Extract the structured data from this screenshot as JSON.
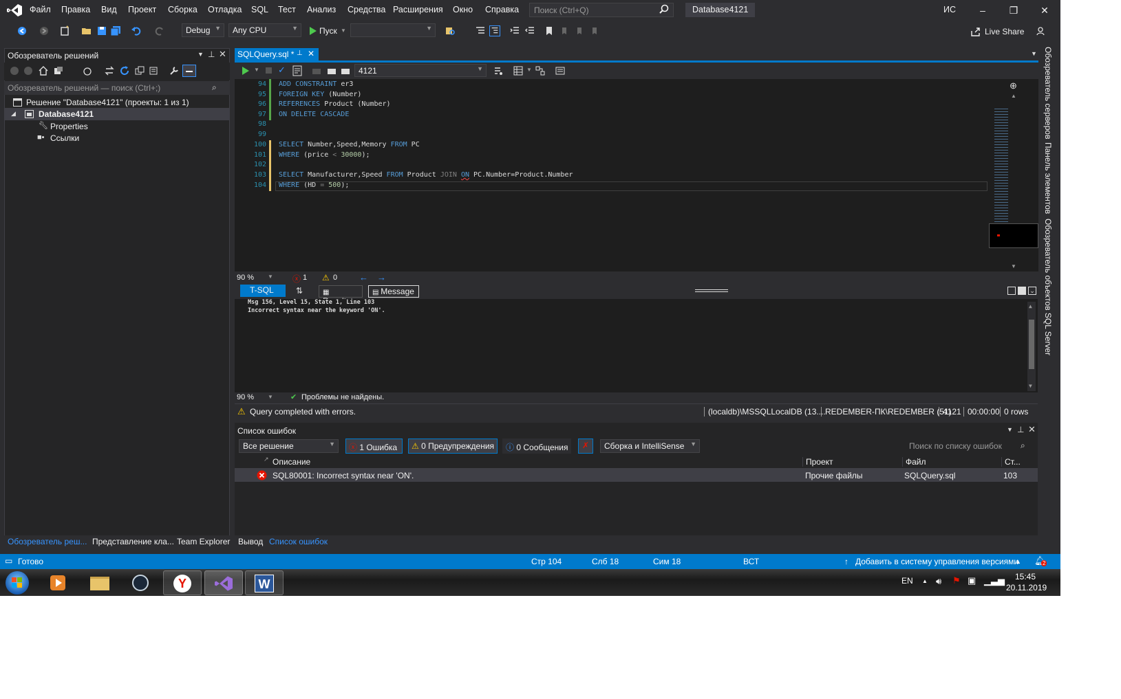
{
  "menu": {
    "items": [
      "Файл",
      "Правка",
      "Вид",
      "Проект",
      "Сборка",
      "Отладка",
      "SQL",
      "Тест",
      "Анализ",
      "Средства",
      "Расширения",
      "Окно",
      "Справка"
    ],
    "search_placeholder": "Поиск (Ctrl+Q)",
    "solution_name": "Database4121",
    "user_initials": "ИС"
  },
  "toolbar": {
    "config": "Debug",
    "platform": "Any CPU",
    "start_label": "Пуск",
    "live_share": "Live Share"
  },
  "solution_explorer": {
    "title": "Обозреватель решений",
    "search_placeholder": "Обозреватель решений — поиск (Ctrl+;)",
    "tree": [
      "Решение \"Database4121\" (проекты: 1 из 1)",
      "Database4121",
      "Properties",
      "Ссылки"
    ],
    "bottom_tabs": [
      "Обозреватель реш...",
      "Представление кла...",
      "Team Explorer"
    ]
  },
  "editor": {
    "tab_title": "SQLQuery.sql *",
    "database": "4121",
    "zoom": "90 %",
    "error_count": "1",
    "warning_count": "0",
    "line_numbers": [
      "94",
      "95",
      "96",
      "97",
      "98",
      "99",
      "100",
      "101",
      "102",
      "103",
      "104"
    ],
    "code": {
      "l94_kw": "ADD CONSTRAINT",
      "l94_rest": " er3",
      "l95_kw": "FOREIGN KEY",
      "l95_rest": " (Number)",
      "l96_kw": "REFERENCES",
      "l96_rest": " Product (Number)",
      "l97_kw": "ON DELETE CASCADE",
      "l100_a": "SELECT",
      "l100_b": " Number,Speed,Memory ",
      "l100_c": "FROM",
      "l100_d": " PC",
      "l101_a": "WHERE",
      "l101_b": " (price ",
      "l101_c": "<",
      "l101_d": " 30000",
      "l101_e": ");",
      "l103_a": "SELECT",
      "l103_b": " Manufacturer,Speed ",
      "l103_c": "FROM",
      "l103_d": " Product ",
      "l103_e": "JOIN",
      "l103_f": "ON",
      "l103_g": " PC.Number=Product.Number",
      "l104_a": "WHERE",
      "l104_b": " (HD ",
      "l104_c": "=",
      "l104_d": " 500",
      "l104_e": ");"
    }
  },
  "results": {
    "tabs": [
      "T-SQL",
      "Results",
      "Message"
    ],
    "messages": [
      "Msg 156, Level 15, State 1, Line 103",
      "Incorrect syntax near the keyword 'ON'."
    ],
    "zoom": "90 %",
    "no_problems": "Проблемы не найдены.",
    "query_status": "Query completed with errors.",
    "server": "(localdb)\\MSSQLLocalDB (13....",
    "login": "REDEMBER-ПК\\REDEMBER (51)",
    "db": "4121",
    "time": "00:00:00",
    "rows": "0 rows"
  },
  "error_list": {
    "title": "Список ошибок",
    "scope": "Все решение",
    "errors_btn": "1 Ошибка",
    "warnings_btn": "0 Предупреждения",
    "messages_btn": "0 Сообщения",
    "build_filter": "Сборка и IntelliSense",
    "search_placeholder": "Поиск по списку ошибок",
    "columns": [
      "Описание",
      "Проект",
      "Файл",
      "Ст..."
    ],
    "row": {
      "description": "SQL80001: Incorrect syntax near 'ON'.",
      "project": "Прочие файлы",
      "file": "SQLQuery.sql",
      "line": "103"
    },
    "bottom_tabs": [
      "Вывод",
      "Список ошибок"
    ]
  },
  "right_tabs": [
    "Обозреватель серверов",
    "Панель элементов",
    "Обозреватель объектов SQL Server"
  ],
  "statusbar": {
    "ready": "Готово",
    "line": "Стр 104",
    "col": "Слб 18",
    "ch": "Сим 18",
    "ins": "ВСТ",
    "source_control": "Добавить в систему управления версиями",
    "notif_count": "2"
  },
  "taskbar": {
    "lang": "EN",
    "time": "15:45",
    "date": "20.11.2019"
  },
  "colors": {
    "accent": "#007acc",
    "background": "#2d2d30",
    "editor": "#1e1e1e",
    "error": "#e51400",
    "warning": "#ffcc00"
  }
}
